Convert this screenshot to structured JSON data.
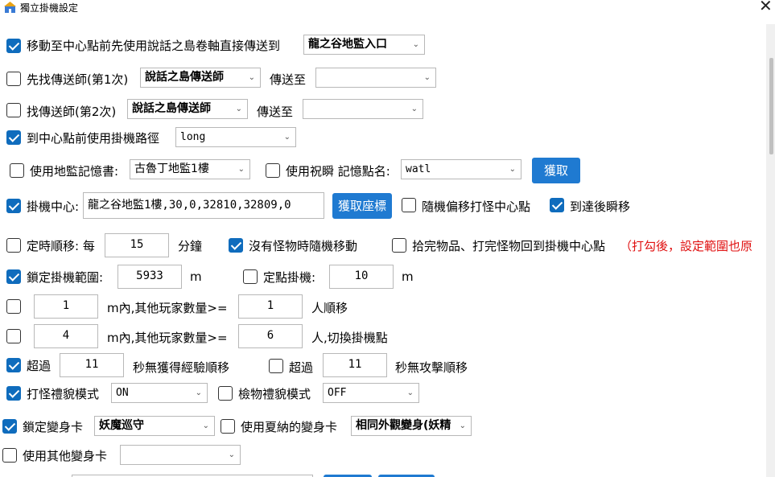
{
  "window": {
    "title": "獨立掛機設定",
    "close": "✕"
  },
  "colors": {
    "accent": "#0f6cbd",
    "button": "#1f7ad1",
    "warning": "#e01010"
  },
  "row1": {
    "checked": true,
    "label": "移動至中心點前先使用說話之島卷軸直接傳送到",
    "select": "龍之谷地監入口"
  },
  "row2": {
    "checked": false,
    "label": "先找傳送師(第1次)",
    "select": "說話之島傳送師",
    "to_label": "傳送至",
    "to_select": ""
  },
  "row3": {
    "checked": false,
    "label": "找傳送師(第2次)",
    "select": "說話之島傳送師",
    "to_label": "傳送至",
    "to_select": ""
  },
  "row4": {
    "checked": true,
    "label": "到中心點前使用掛機路徑",
    "select": "long"
  },
  "row5": {
    "dungeon_checked": false,
    "dungeon_label": "使用地監記憶書:",
    "dungeon_select": "古魯丁地監1樓",
    "bless_checked": false,
    "bless_label": "使用祝瞬 記憶點名:",
    "bless_select": "watl",
    "fetch_button": "獲取"
  },
  "row6": {
    "center_checked": true,
    "center_label": "掛機中心:",
    "center_value": "龍之谷地監1樓,30,0,32810,32809,0",
    "coord_button": "獲取座標",
    "random_checked": false,
    "random_label": "隨機偏移打怪中心點",
    "teleport_checked": true,
    "teleport_label": "到達後瞬移"
  },
  "row7": {
    "timed_checked": false,
    "timed_label": "定時順移: 每",
    "timed_value": "15",
    "timed_unit": "分鐘",
    "nomonster_checked": true,
    "nomonster_label": "沒有怪物時隨機移動",
    "return_checked": false,
    "return_label": "拾完物品、打完怪物回到掛機中心點",
    "return_note": "（打勾後，設定範圍也原",
    "return_note_color": "#e01010"
  },
  "row8": {
    "lock_checked": true,
    "lock_label": "鎖定掛機範圍:",
    "lock_value": "5933",
    "lock_unit": "m",
    "fixed_checked": false,
    "fixed_label": "定點掛機:",
    "fixed_value": "10",
    "fixed_unit": "m"
  },
  "row9": {
    "checked": false,
    "range": "1",
    "label": "m內,其他玩家數量>=",
    "count": "1",
    "suffix": "人順移"
  },
  "row10": {
    "checked": false,
    "range": "4",
    "label": "m內,其他玩家數量>=",
    "count": "6",
    "suffix": "人,切換掛機點"
  },
  "row11": {
    "exp_checked": true,
    "exp_prefix": "超過",
    "exp_value": "11",
    "exp_label": "秒無獲得經驗順移",
    "atk_checked": false,
    "atk_prefix": "超過",
    "atk_value": "11",
    "atk_label": "秒無攻擊順移"
  },
  "row12": {
    "fight_checked": true,
    "fight_label": "打怪禮貌模式",
    "fight_select": "ON",
    "pick_checked": false,
    "pick_label": "檢物禮貌模式",
    "pick_select": "OFF"
  },
  "row13": {
    "morph_checked": true,
    "morph_label": "鎖定變身卡",
    "morph_select": "妖魔巡守",
    "summer_checked": false,
    "summer_label": "使用夏納的變身卡",
    "summer_select": "相同外觀變身(妖精"
  },
  "row14": {
    "checked": false,
    "label": "使用其他變身卡",
    "select": ""
  }
}
